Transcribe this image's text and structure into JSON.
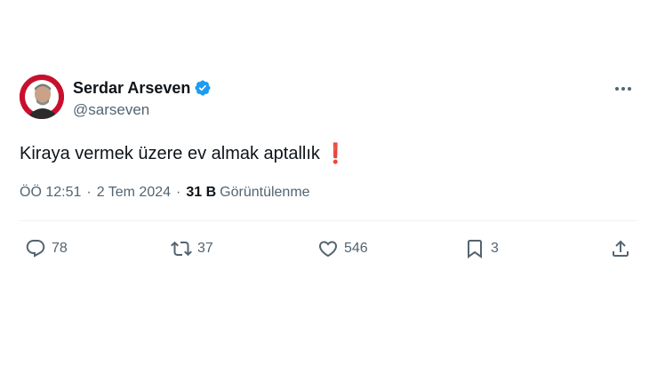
{
  "user": {
    "display_name": "Serdar Arseven",
    "handle": "@sarseven",
    "verified": true,
    "verified_color": "#1d9bf0",
    "avatar_color": "#c8102e"
  },
  "tweet": {
    "text": "Kiraya vermek üzere ev almak aptallık",
    "emoji": "❗",
    "time": "ÖÖ 12:51",
    "dot1": "·",
    "date": "2 Tem 2024",
    "dot2": "·",
    "views_count": "31 B",
    "views_label": "Görüntülenme"
  },
  "actions": {
    "reply_count": "78",
    "retweet_count": "37",
    "like_count": "546",
    "bookmark_count": "3"
  },
  "icons": [
    "more-icon",
    "verified-badge-icon",
    "reply-icon",
    "retweet-icon",
    "like-icon",
    "bookmark-icon",
    "share-icon"
  ]
}
